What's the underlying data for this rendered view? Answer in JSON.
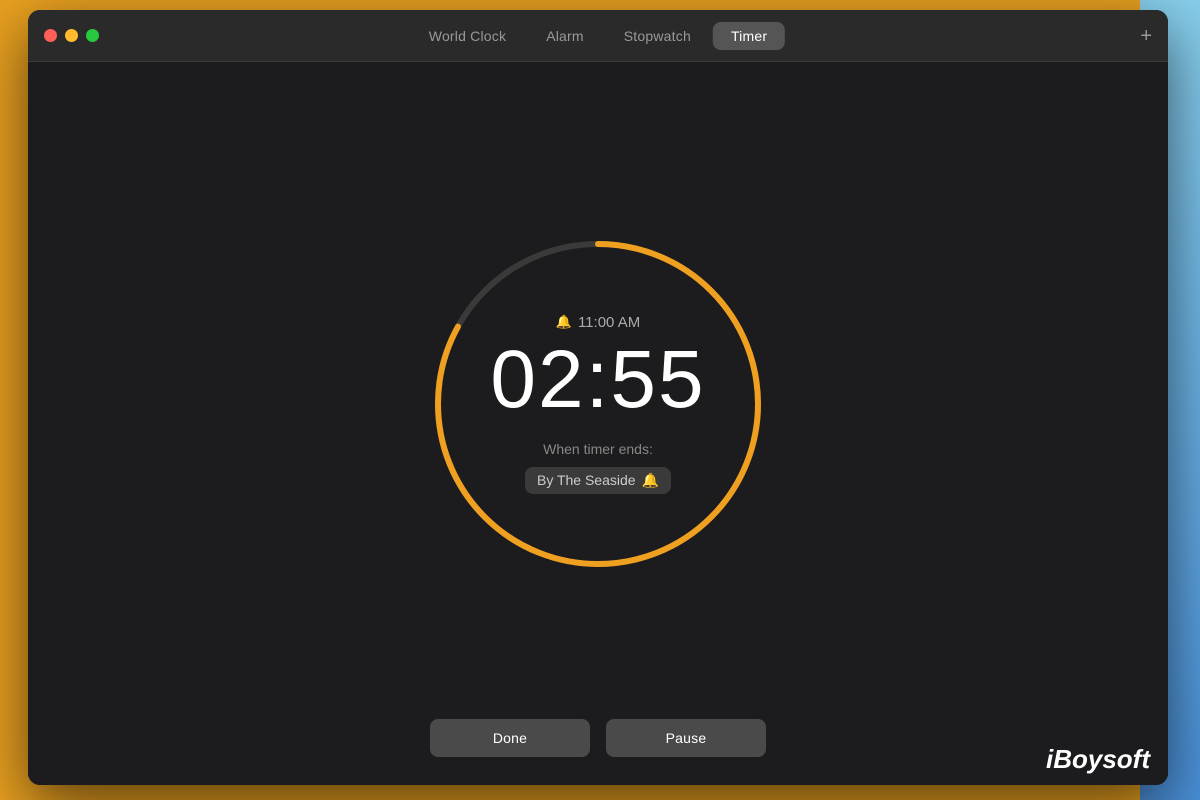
{
  "titlebar": {
    "tabs": [
      {
        "id": "world-clock",
        "label": "World Clock",
        "active": false
      },
      {
        "id": "alarm",
        "label": "Alarm",
        "active": false
      },
      {
        "id": "stopwatch",
        "label": "Stopwatch",
        "active": false
      },
      {
        "id": "timer",
        "label": "Timer",
        "active": true
      }
    ],
    "add_button_label": "+"
  },
  "timer": {
    "alarm_time": "11:00 AM",
    "display": "02:55",
    "when_ends_label": "When timer ends:",
    "sound_name": "By The Seaside",
    "sound_emoji": "🔔"
  },
  "buttons": {
    "done_label": "Done",
    "pause_label": "Pause"
  },
  "watermark": {
    "prefix": "i",
    "suffix": "Boysoft"
  },
  "progress": {
    "percent": 0.83,
    "track_color": "#3a3a3a",
    "arc_color": "#f0a020"
  }
}
